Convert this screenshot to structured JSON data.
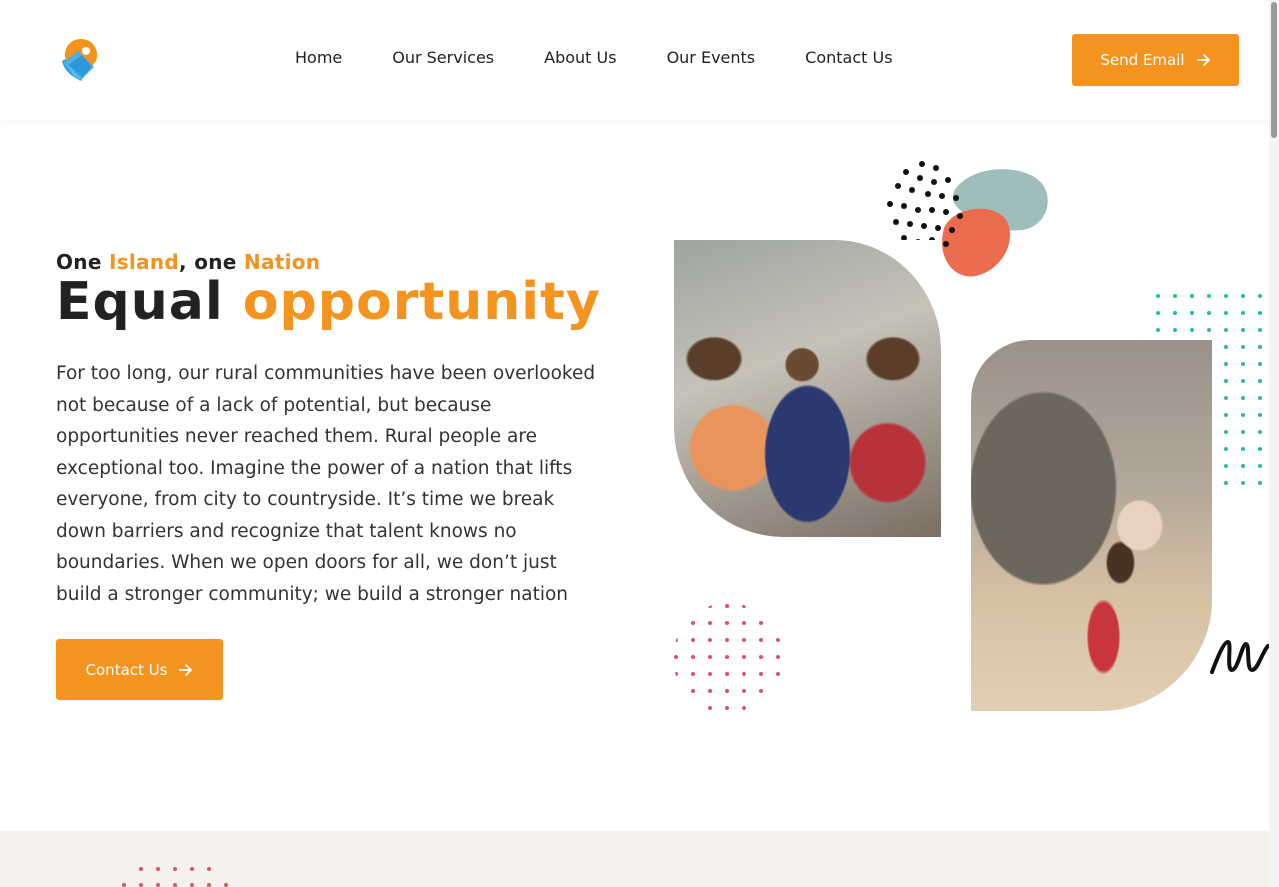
{
  "header": {
    "logo": "logo-icon",
    "nav": [
      {
        "label": "Home"
      },
      {
        "label": "Our Services"
      },
      {
        "label": "About Us"
      },
      {
        "label": "Our Events"
      },
      {
        "label": "Contact Us"
      }
    ],
    "send_button": {
      "label": "Send Email",
      "icon": "arrow-right-icon"
    }
  },
  "hero": {
    "subtitle": {
      "part1": "One",
      "part2": "Island",
      "part3": ", one",
      "part4": "Nation"
    },
    "title": {
      "part1": "Equal",
      "part2": "opportunity"
    },
    "body": "For too long, our rural communities have been overlooked not because of a lack of potential, but because opportunities never reached them. Rural people are exceptional too. Imagine the power of a nation that lifts everyone, from city to countryside. It’s time we break down barriers and recognize that talent knows no boundaries. When we open doors for all, we don’t just build a stronger community; we build a stronger nation",
    "contact_button": {
      "label": "Contact Us",
      "icon": "arrow-right-icon"
    }
  },
  "colors": {
    "accent": "#f4931e",
    "coral": "#ea6b4d",
    "sage": "#9fbdbb",
    "teal_dots": "#2bb7a8",
    "pink_dots": "#e0506a",
    "section_bg": "#f5f1ec"
  }
}
